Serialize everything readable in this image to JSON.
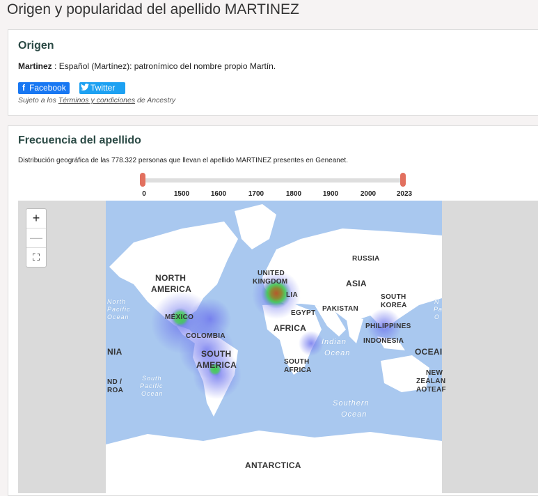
{
  "page": {
    "title": "Origen y popularidad del apellido MARTINEZ"
  },
  "origin": {
    "heading": "Origen",
    "surname": "Martinez",
    "description": " : Español (Martínez): patronímico del nombre propio Martín.",
    "facebook_label": "Facebook",
    "twitter_label": "Twitter",
    "terms_prefix": "Sujeto a los ",
    "terms_link": "Términos y condiciones",
    "terms_suffix": " de Ancestry"
  },
  "frequency": {
    "heading": "Frecuencia del apellido",
    "description": "Distribución geográfica de las 778.322 personas que llevan el apellido MARTINEZ presentes en Geneanet.",
    "slider": {
      "min": 0,
      "max": 2023,
      "ticks": [
        "0",
        "1500",
        "1600",
        "1700",
        "1800",
        "1900",
        "2000",
        "2023"
      ]
    },
    "map": {
      "zoom_in": "+",
      "zoom_out": "—",
      "fullscreen": "⛶",
      "labels": {
        "north_america_1": "NORTH",
        "north_america_2": "AMERICA",
        "mexico": "MÉXICO",
        "colombia": "COLOMBIA",
        "south_america_1": "SOUTH",
        "south_america_2": "AMERICA",
        "united_kingdom_1": "UNITED",
        "united_kingdom_2": "KINGDOM",
        "italia": "LIA",
        "russia": "RUSSIA",
        "asia": "ASIA",
        "pakistan": "PAKISTAN",
        "south_korea_1": "SOUTH",
        "south_korea_2": "KOREA",
        "egypt": "EGYPT",
        "africa": "AFRICA",
        "philippines": "PHILIPPINES",
        "indonesia": "INDONESIA",
        "south_africa_1": "SOUTH",
        "south_africa_2": "AFRICA",
        "antarctica": "ANTARCTICA",
        "oceania_left": "NIA",
        "oceania_right": "OCEAI",
        "nz_left_1": "ND /",
        "nz_left_2": "ROA",
        "nz_right_1": "NEW",
        "nz_right_2": "ZEALAN",
        "nz_right_3": "AOTEAF"
      },
      "oceans": {
        "indian_1": "Indian",
        "indian_2": "Ocean",
        "southern_1": "Southern",
        "southern_2": "Ocean",
        "north_pacific_1": "North",
        "north_pacific_2": "Pacific",
        "north_pacific_3": "Ocean",
        "south_pacific_1": "South",
        "south_pacific_2": "Pacific",
        "south_pacific_3": "Ocean",
        "north_pacific_right_1": "N",
        "north_pacific_right_2": "Pa",
        "north_pacific_right_3": "O"
      },
      "colors": {
        "ocean": "#a9c8ef",
        "land": "#ffffff",
        "heat_low": "#6f76ee",
        "heat_mid": "#3fd04a",
        "heat_high": "#b6592c"
      }
    }
  }
}
